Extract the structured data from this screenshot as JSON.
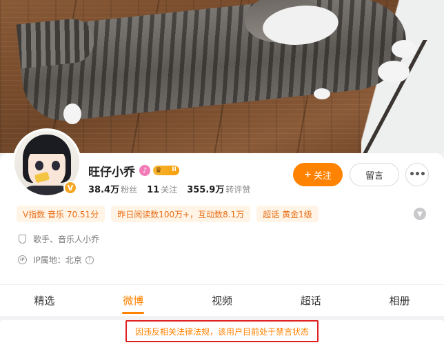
{
  "profile": {
    "name": "旺仔小乔",
    "crown_level": "II",
    "verified_mark": "V",
    "stats": [
      {
        "value": "38.4万",
        "label": "粉丝"
      },
      {
        "value": "11",
        "label": "关注"
      },
      {
        "value": "355.9万",
        "label": "转评赞"
      }
    ]
  },
  "actions": {
    "follow_plus": "+",
    "follow_label": "关注",
    "message_label": "留言",
    "more_label": "•••"
  },
  "tags": [
    "V指数 音乐 70.51分",
    "昨日阅读数100万+，互动数8.1万",
    "超话 黄金1级"
  ],
  "info": {
    "bio": "歌手、音乐人小乔",
    "ip_location": "IP属地：北京"
  },
  "tabs": [
    "精选",
    "微博",
    "视频",
    "超话",
    "相册"
  ],
  "active_tab": "微博",
  "notice": "因违反相关法律法规，该用户目前处于禁言状态",
  "colors": {
    "accent": "#ff8200",
    "tag_bg": "#fff4e6",
    "tag_text": "#e96e16",
    "notice_border": "#e02020"
  },
  "icons": {
    "music_badge": "music-note-icon",
    "crown": "crown-icon",
    "bio": "shield-icon",
    "ip": "ip-icon",
    "help": "question-icon",
    "expand": "chevron-down-icon"
  }
}
